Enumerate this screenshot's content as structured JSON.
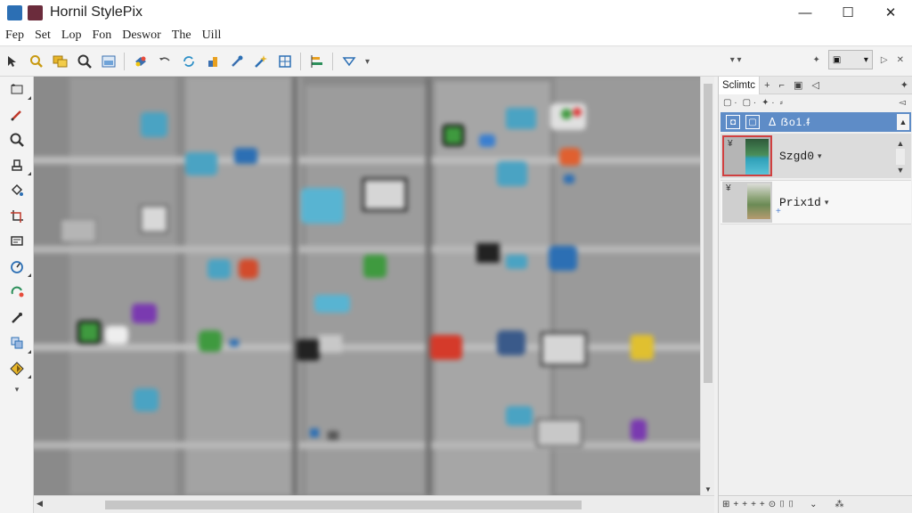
{
  "app": {
    "title": "Hornil StylePix"
  },
  "window": {
    "minimize": "—",
    "maximize": "☐",
    "close": "✕"
  },
  "menu": [
    "Fep",
    "Set",
    "Lop",
    "Fon",
    "Deswor",
    "The",
    "Uill"
  ],
  "toolbar": {
    "icons": [
      "pointer-icon",
      "zoom-icon",
      "layers-icon",
      "search-icon",
      "image-icon",
      "brush-preset-icon",
      "undo-icon",
      "refresh-icon",
      "crop-icon",
      "eyedropper-icon",
      "magic-wand-icon",
      "grid-icon",
      "align-icon",
      "filter-icon"
    ],
    "right_combo_label": "▾",
    "play_label": "▷",
    "expand_label": "✕"
  },
  "left_tools": [
    "move-tool",
    "pen-tool",
    "magnifier-tool",
    "stamp-tool",
    "fill-tool",
    "crop-tool",
    "text-tool",
    "compass-tool",
    "color-tool",
    "dropper-tool",
    "clone-tool",
    "gradient-tool"
  ],
  "panel": {
    "tab_label": "Sclimtc",
    "head_text": "ᐃ ẞo1.ᵮ",
    "layers": [
      {
        "name": "Szgd0",
        "visible_mark": "¥"
      },
      {
        "name": "Prix1d",
        "visible_mark": "¥"
      }
    ]
  },
  "colors": {
    "accent": "#5e8cc7",
    "selected_border": "#d04040"
  }
}
